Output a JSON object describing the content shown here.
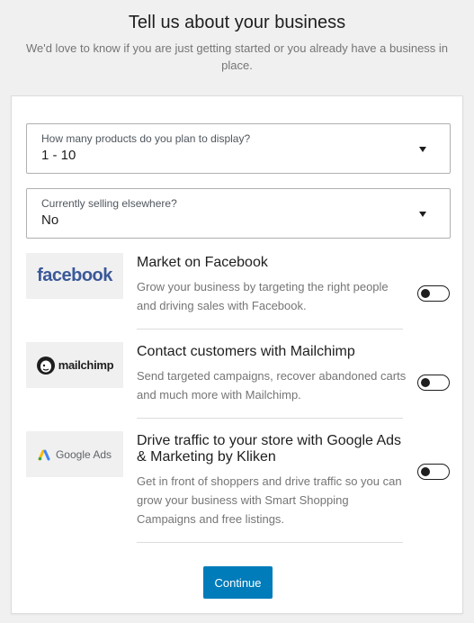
{
  "header": {
    "title": "Tell us about your business",
    "subtitle": "We'd love to know if you are just getting started or you already have a business in place."
  },
  "fields": {
    "products": {
      "label": "How many products do you plan to display?",
      "value": "1 - 10"
    },
    "selling": {
      "label": "Currently selling elsewhere?",
      "value": "No"
    }
  },
  "extensions": [
    {
      "logo_text": "facebook",
      "title": "Market on Facebook",
      "description": "Grow your business by targeting the right people and driving sales with Facebook.",
      "enabled": false
    },
    {
      "logo_text": "mailchimp",
      "title": "Contact customers with Mailchimp",
      "description": "Send targeted campaigns, recover abandoned carts and much more with Mailchimp.",
      "enabled": false
    },
    {
      "logo_text": "Google Ads",
      "title": "Drive traffic to your store with Google Ads & Marketing by Kliken",
      "description": "Get in front of shoppers and drive traffic so you can grow your business with Smart Shopping Campaigns and free listings.",
      "enabled": false
    }
  ],
  "actions": {
    "continue_label": "Continue"
  },
  "colors": {
    "primary": "#007cba",
    "facebook": "#3b5998",
    "muted": "#757575"
  }
}
